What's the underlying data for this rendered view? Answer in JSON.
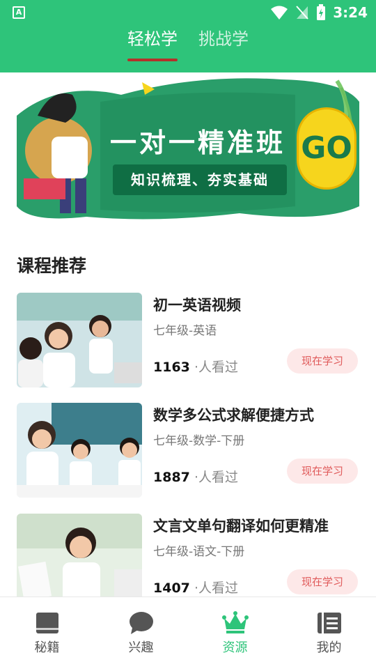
{
  "status": {
    "time": "3:24",
    "app_icon": "A"
  },
  "tabs": [
    {
      "label": "轻松学",
      "active": true
    },
    {
      "label": "挑战学",
      "active": false
    }
  ],
  "banner": {
    "title": "一对一精准班",
    "subtitle": "知识梳理、夯实基础",
    "go": "GO"
  },
  "section": {
    "title": "课程推荐"
  },
  "courses": [
    {
      "name": "初一英语视频",
      "meta": "七年级-英语",
      "views": "1163",
      "views_suffix": "·人看过",
      "button": "现在学习"
    },
    {
      "name": "数学多公式求解便捷方式",
      "meta": "七年级-数学-下册",
      "views": "1887",
      "views_suffix": "·人看过",
      "button": "现在学习"
    },
    {
      "name": "文言文单句翻译如何更精准",
      "meta": "七年级-语文-下册",
      "views": "1407",
      "views_suffix": "·人看过",
      "button": "现在学习"
    }
  ],
  "bottom_nav": [
    {
      "label": "秘籍",
      "icon": "book-icon",
      "active": false
    },
    {
      "label": "兴趣",
      "icon": "chat-bubble-icon",
      "active": false
    },
    {
      "label": "资源",
      "icon": "crown-icon",
      "active": true
    },
    {
      "label": "我的",
      "icon": "profile-list-icon",
      "active": false
    }
  ],
  "colors": {
    "brand": "#2ec47a",
    "tab_indicator": "#b4322a",
    "button_bg": "#fde8e8",
    "button_text": "#e05a5a"
  }
}
